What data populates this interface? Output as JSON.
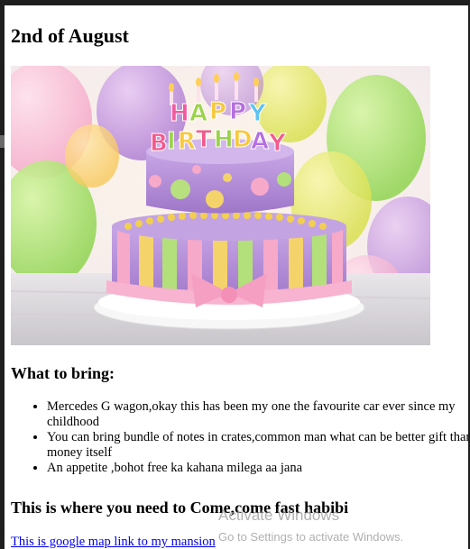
{
  "page": {
    "heading": "2nd of August",
    "image_alt": "Birthday cake",
    "cake_letters": {
      "happy": [
        "H",
        "A",
        "P",
        "P",
        "Y"
      ],
      "birthday": [
        "B",
        "I",
        "R",
        "T",
        "H",
        "D",
        "A",
        "Y"
      ]
    },
    "bring_heading": "What to bring:",
    "bring_items": [
      "Mercedes G wagon,okay this has been my one the favourite car ever since my childhood",
      "You can bring bundle of notes in crates,common man what can be better gift than money itself",
      "An appetite ,bohot free ka kahana milega aa jana"
    ],
    "come_heading": "This is where you need to Come,come fast habibi",
    "map_link": "This is google map link to my mansion"
  },
  "watermark": {
    "title": "Activate Windows",
    "subtitle": "Go to Settings to activate Windows."
  },
  "colors": {
    "link": "#0000ee",
    "frame": "#1e1e1e",
    "watermark": "#969696"
  }
}
